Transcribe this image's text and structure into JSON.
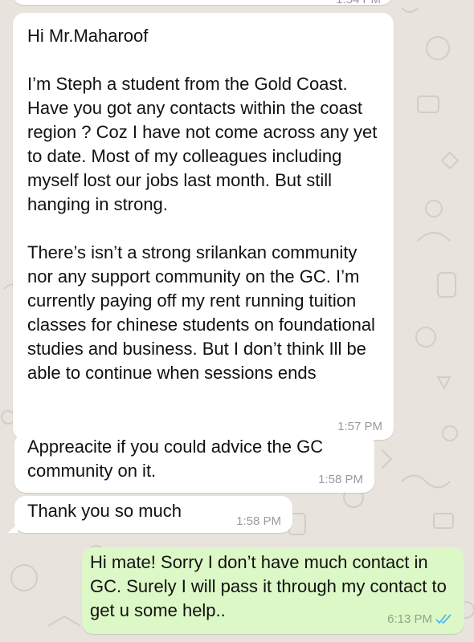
{
  "colors": {
    "wallpaper": "#e8e3dc",
    "incoming_bubble": "#ffffff",
    "outgoing_bubble": "#dcf8c6",
    "timestamp": "#9a9a9a",
    "read_ticks": "#4fb6ec"
  },
  "chat": {
    "clipped_top_time": "1:54 PM",
    "messages": [
      {
        "direction": "incoming",
        "text": "Hi Mr.Maharoof\n\nI’m Steph a student from the Gold Coast. Have you got any contacts within the coast region ? Coz I have not come across any yet to date. Most of my colleagues including myself lost our jobs last month. But still hanging in strong.\n\nThere’s isn’t a strong srilankan community nor any support community on the GC. I’m currently paying off my rent running tuition classes for chinese students on foundational studies and business. But I don’t think Ill be able to continue when sessions ends",
        "time": "1:57 PM"
      },
      {
        "direction": "incoming",
        "text": "Appreacite if you could advice the GC community on it.",
        "time": "1:58 PM"
      },
      {
        "direction": "incoming",
        "text": "Thank you so much",
        "time": "1:58 PM"
      },
      {
        "direction": "outgoing",
        "text": "Hi mate! Sorry I don’t have much contact in GC. Surely I will pass it through my contact to get u some help..",
        "time": "6:13 PM",
        "status_icon": "double-check-read-icon"
      }
    ]
  }
}
